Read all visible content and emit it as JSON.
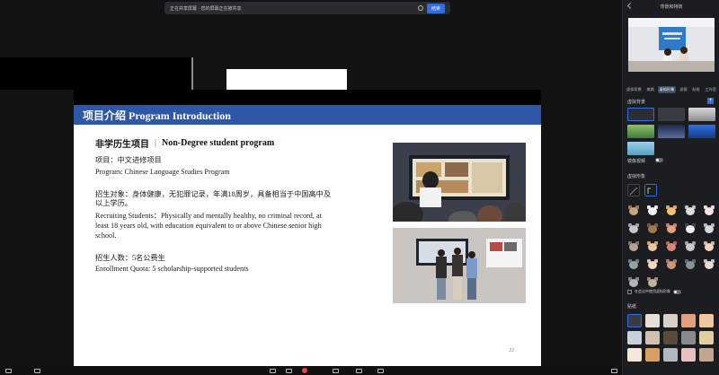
{
  "share_bar": {
    "text": "正在共享屏幕 · 您的屏幕正在被共享",
    "stop_label": "结束"
  },
  "slide": {
    "title": "项目介绍 Program Introduction",
    "subheading_cn": "非学历生项目",
    "subheading_en": "Non-Degree student program",
    "project_cn": "项目：中文进修项目",
    "project_en": "Program: Chinese Language Studies Program",
    "recruit_cn_1": "招生对象：身体健康，无犯罪记录，年满18周岁，具备相当于中国高中及",
    "recruit_cn_2": "以上学历。",
    "recruit_en_1": "Recruiting Students：Physically and mentally healthy, no criminal record, at",
    "recruit_en_2": "least 18 years old, with education equivalent to or above Chinese senior high",
    "recruit_en_3": "school.",
    "quota_cn": "招生人数：5名公费生",
    "quota_en": "Enrollment Quota: 5 scholarship-supported students",
    "page_number": "22"
  },
  "sidebar": {
    "header": "背景和特效",
    "tabs": [
      "虚拟背景",
      "美颜",
      "虚拟形象",
      "滤镜",
      "贴纸",
      "工作室"
    ],
    "active_tab": 2,
    "section_background": "虚拟背景",
    "mirror_label": "镜像视频",
    "section_filter": "虚拟形象",
    "checkbox_label": "在会议中使用虚拟形象",
    "section_sticker": "贴纸",
    "colors": {
      "accent": "#2f6fe0",
      "panel": "#1c1d20"
    }
  },
  "bottom_bar": {
    "icons": [
      "mic-icon",
      "camera-icon",
      "security-icon",
      "participants-icon",
      "share-icon",
      "record-icon",
      "reactions-icon",
      "apps-icon",
      "more-icon"
    ]
  }
}
